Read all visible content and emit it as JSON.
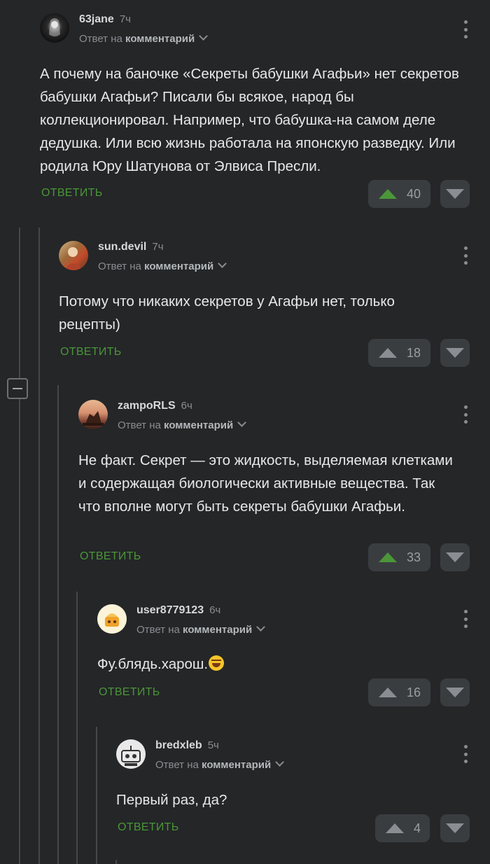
{
  "ui": {
    "reply_prefix": "Ответ на",
    "reply_target": "комментарий",
    "reply_label": "ОТВЕТИТЬ"
  },
  "colors": {
    "background": "#242628",
    "accent_green": "#4b9638",
    "button_bg": "#3a3d40"
  },
  "comments": [
    {
      "username": "63jane",
      "time": "7ч",
      "avatar": "dark-portrait-avatar",
      "text": "А почему на баночке «Секреты бабушки Агафьи» нет секретов бабушки Агафьи? Писали бы всякое, народ бы коллекционировал. Например, что бабушка-на самом деле дедушка. Или всю жизнь работала на японскую разведку. Или родила Юру Шатунова от Элвиса Пресли.",
      "votes": "40",
      "upvote_active": true
    },
    {
      "username": "sun.devil",
      "time": "7ч",
      "avatar": "painting-avatar",
      "text": "Потому что никаких секретов у Агафьи нет, только рецепты)",
      "votes": "18",
      "upvote_active": false
    },
    {
      "username": "zampoRLS",
      "time": "6ч",
      "avatar": "sunset-sculpture-avatar",
      "text": "Не факт. Секрет — это жидкость, выделяемая клетками и содержащая биологически активные вещества. Так что вполне могут быть секреты бабушки Агафьи.",
      "votes": "33",
      "upvote_active": true
    },
    {
      "username": "user8779123",
      "time": "6ч",
      "avatar": "cartoon-avatar",
      "text": "Фу.блядь.харош.",
      "emoji": "rolling-on-floor-laughing-emoji",
      "votes": "16",
      "upvote_active": false
    },
    {
      "username": "bredxleb",
      "time": "5ч",
      "avatar": "robot-sketch-avatar",
      "text": "Первый раз, да?",
      "votes": "4",
      "upvote_active": false
    }
  ]
}
